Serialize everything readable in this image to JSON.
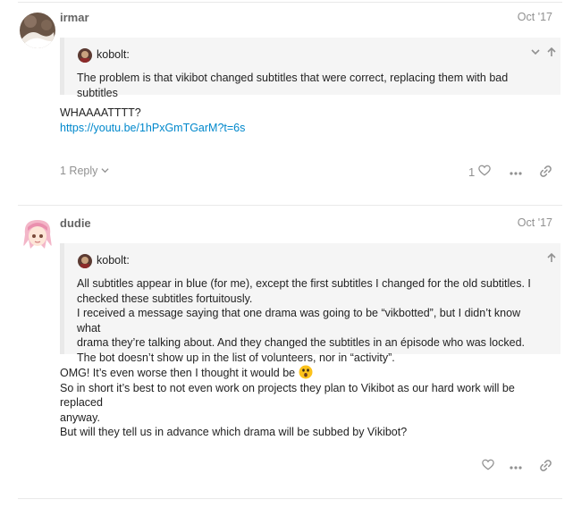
{
  "posts": [
    {
      "username": "irmar",
      "date": "Oct '17",
      "quote": {
        "author": "kobolt:",
        "lines": [
          "The problem is that vikibot changed subtitles that were correct, replacing them with bad subtitles"
        ]
      },
      "body": {
        "line1": "WHAAAATTTT?",
        "link": "https://youtu.be/1hPxGmTGarM?t=6s"
      },
      "replies_label": "1 Reply",
      "like_count": "1",
      "icons": [
        "chevron-down-icon",
        "chevron-up-icon",
        "heart-icon",
        "more-icon",
        "link-icon"
      ]
    },
    {
      "username": "dudie",
      "date": "Oct '17",
      "quote": {
        "author": "kobolt:",
        "lines": [
          "All subtitles appear in blue (for me), except the first subtitles I changed for the old subtitles. I",
          "checked these subtitles fortuitously.",
          "I received a message saying that one drama was going to be “vikbotted”, but I didn’t know what",
          "drama they’re talking about. And they changed the subtitles in an épisode who was locked.",
          "The bot doesn’t show up in the list of volunteers, nor in “activity”."
        ]
      },
      "body": {
        "line1": "OMG! It’s even worse then I thought it would be",
        "line2": "So in short it’s best to not even work on projects they plan to Vikibot as our hard work will be replaced",
        "line3": "anyway.",
        "line4": "But will they tell us in advance which drama will be subbed by Vikibot?"
      },
      "icons": [
        "chevron-up-icon",
        "heart-icon",
        "more-icon",
        "link-icon",
        "astonished-emoji"
      ]
    }
  ],
  "colors": {
    "link": "#0088cc",
    "meta": "#919191",
    "quote_bg": "#f5f5f5"
  }
}
